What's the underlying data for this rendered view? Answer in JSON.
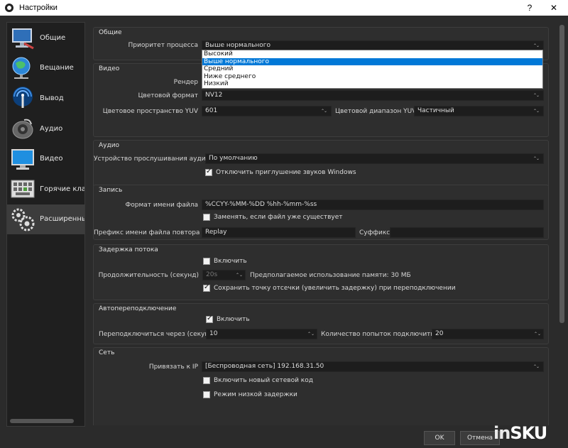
{
  "window": {
    "title": "Настройки",
    "help": "?",
    "close": "✕"
  },
  "sidebar": {
    "items": [
      {
        "label": "Общие",
        "icon": "monitor-pen-icon"
      },
      {
        "label": "Вещание",
        "icon": "globe-network-icon"
      },
      {
        "label": "Вывод",
        "icon": "broadcast-antenna-icon"
      },
      {
        "label": "Аудио",
        "icon": "speaker-icon"
      },
      {
        "label": "Видео",
        "icon": "monitor-icon"
      },
      {
        "label": "Горячие клавиши",
        "icon": "keyboard-icon"
      },
      {
        "label": "Расширенные",
        "icon": "gears-icon"
      }
    ]
  },
  "general": {
    "title": "Общие",
    "priority_label": "Приоритет процесса",
    "priority_value": "Выше нормального",
    "priority_options": [
      "Высокий",
      "Выше нормального",
      "Средний",
      "Ниже среднего",
      "Низкий"
    ]
  },
  "video": {
    "title": "Видео",
    "renderer_label": "Рендер",
    "color_format_label": "Цветовой формат",
    "color_format_value": "NV12",
    "color_space_label": "Цветовое пространство YUV",
    "color_space_value": "601",
    "color_range_label": "Цветовой диапазон YUV",
    "color_range_value": "Частичный"
  },
  "audio": {
    "title": "Аудио",
    "device_label": "Устройство прослушивания аудио",
    "device_value": "По умолчанию",
    "disable_ducking": "Отключить приглушение звуков Windows"
  },
  "recording": {
    "title": "Запись",
    "filename_label": "Формат имени файла",
    "filename_value": "%CCYY-%MM-%DD %hh-%mm-%ss",
    "overwrite": "Заменять, если файл уже существует",
    "replay_prefix_label": "Префикс имени файла повтора",
    "replay_prefix_value": "Replay",
    "suffix_label": "Суффикс",
    "suffix_value": ""
  },
  "stream_delay": {
    "title": "Задержка потока",
    "enable": "Включить",
    "duration_label": "Продолжительность (секунд)",
    "duration_value": "20s",
    "memory_text": "Предполагаемое использование памяти: 30 МБ",
    "preserve": "Сохранить точку отсечки (увеличить задержку) при переподключении"
  },
  "reconnect": {
    "title": "Автопереподключение",
    "enable": "Включить",
    "retry_delay_label": "Переподключиться через (секунд)",
    "retry_delay_value": "10",
    "max_retries_label": "Количество попыток подключиться",
    "max_retries_value": "20"
  },
  "network": {
    "title": "Сеть",
    "bind_ip_label": "Привязать к IP",
    "bind_ip_value": "[Беспроводная сеть] 192.168.31.50",
    "new_network_code": "Включить новый сетевой код",
    "low_latency": "Режим низкой задержки"
  },
  "buttons": {
    "ok": "OK",
    "cancel": "Отмена"
  },
  "watermark": {
    "part1": "in",
    "part2": "SKU"
  }
}
